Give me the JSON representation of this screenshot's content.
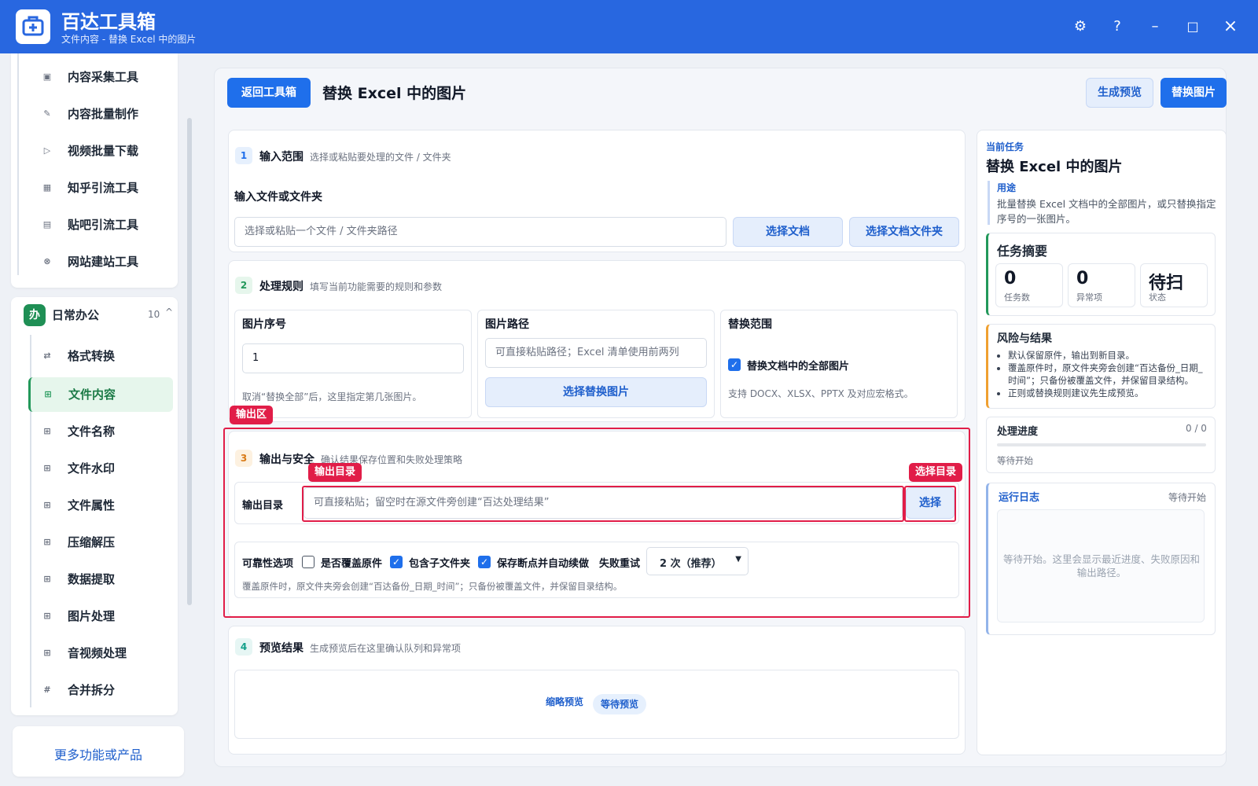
{
  "window": {
    "app_name": "百达工具箱",
    "subtitle": "文件内容 - 替换 Excel 中的图片",
    "settings_glyph": "⚙",
    "help_glyph": "?",
    "minimize_glyph": "–",
    "maximize_glyph": "□",
    "close_glyph": "×"
  },
  "sidebar": {
    "group1_items": [
      {
        "icon": "▣",
        "label": "内容采集工具"
      },
      {
        "icon": "✎",
        "label": "内容批量制作"
      },
      {
        "icon": "▷",
        "label": "视频批量下载"
      },
      {
        "icon": "▦",
        "label": "知乎引流工具"
      },
      {
        "icon": "▤",
        "label": "贴吧引流工具"
      },
      {
        "icon": "⊗",
        "label": "网站建站工具"
      }
    ],
    "group2": {
      "badge": "办",
      "title": "日常办公",
      "count": "10",
      "caret": "^",
      "items": [
        {
          "icon": "⇄",
          "label": "格式转换"
        },
        {
          "icon": "⊞",
          "label": "文件内容"
        },
        {
          "icon": "⊞",
          "label": "文件名称"
        },
        {
          "icon": "⊞",
          "label": "文件水印"
        },
        {
          "icon": "⊞",
          "label": "文件属性"
        },
        {
          "icon": "⊞",
          "label": "压缩解压"
        },
        {
          "icon": "⊞",
          "label": "数据提取"
        },
        {
          "icon": "⊞",
          "label": "图片处理"
        },
        {
          "icon": "⊞",
          "label": "音视频处理"
        },
        {
          "icon": "#",
          "label": "合并拆分"
        }
      ]
    },
    "more_button": "更多功能或产品"
  },
  "toolbar": {
    "back_button": "返回工具箱",
    "title": "替换 Excel 中的图片",
    "preview_button": "生成预览",
    "replace_button": "替换图片"
  },
  "section1": {
    "num": "1",
    "title": "输入范围",
    "hint": "选择或粘贴要处理的文件 / 文件夹",
    "field_label": "输入文件或文件夹",
    "placeholder": "选择或粘贴一个文件 / 文件夹路径",
    "btn_doc": "选择文档",
    "btn_folder": "选择文档文件夹"
  },
  "section2": {
    "num": "2",
    "title": "处理规则",
    "hint": "填写当前功能需要的规则和参数",
    "col1_label": "图片序号",
    "col1_value": "1",
    "col1_note": "取消“替换全部”后，这里指定第几张图片。",
    "col2_label": "图片路径",
    "col2_placeholder": "可直接粘贴路径；Excel 清单使用前两列",
    "col2_button": "选择替换图片",
    "col3_label": "替换范围",
    "col3_check": "替换文档中的全部图片",
    "col3_note": "支持 DOCX、XLSX、PPTX 及对应宏格式。"
  },
  "section3": {
    "num": "3",
    "title": "输出与安全",
    "hint": "确认结果保存位置和失败处理策略",
    "out_label": "输出目录",
    "out_placeholder": "可直接粘贴；留空时在源文件旁创建“百达处理结果”",
    "out_button": "选择",
    "rel_label": "可靠性选项",
    "opt_overwrite": "是否覆盖原件",
    "opt_subfolder": "包含子文件夹",
    "opt_resume": "保存断点并自动续做",
    "retry_label": "失败重试",
    "retry_value": "2 次（推荐）",
    "note": "覆盖原件时，原文件夹旁会创建“百达备份_日期_时间”；只备份被覆盖文件，并保留目录结构。"
  },
  "section4": {
    "num": "4",
    "title": "预览结果",
    "hint": "生成预览后在这里确认队列和异常项",
    "thumb_label": "缩略预览",
    "status_pill": "等待预览"
  },
  "annotations": {
    "output_area": "输出区",
    "output_dir": "输出目录",
    "choose_dir": "选择目录"
  },
  "right_panel": {
    "current_task_label": "当前任务",
    "task_title": "替换 Excel 中的图片",
    "usage_label": "用途",
    "usage_text": "批量替换 Excel 文档中的全部图片，或只替换指定序号的一张图片。",
    "summary_title": "任务摘要",
    "stats": [
      {
        "value": "0",
        "key": "任务数"
      },
      {
        "value": "0",
        "key": "异常项"
      },
      {
        "value": "待扫",
        "key": "状态"
      }
    ],
    "risk_title": "风险与结果",
    "risk_items": [
      "默认保留原件，输出到新目录。",
      "覆盖原件时，原文件夹旁会创建“百达备份_日期_时间”；只备份被覆盖文件，并保留目录结构。",
      "正则或替换规则建议先生成预览。"
    ],
    "progress_title": "处理进度",
    "progress_count": "0 / 0",
    "progress_fraction": 0,
    "progress_status": "等待开始",
    "log_title": "运行日志",
    "log_status": "等待开始",
    "log_placeholder": "等待开始。这里会显示最近进度、失败原因和输出路径。"
  },
  "colors": {
    "brand": "#2867e0",
    "primary_button": "#1f6feb",
    "active_green": "#22985a",
    "annotation_red": "#e11d48",
    "risk_orange": "#f0a030"
  }
}
